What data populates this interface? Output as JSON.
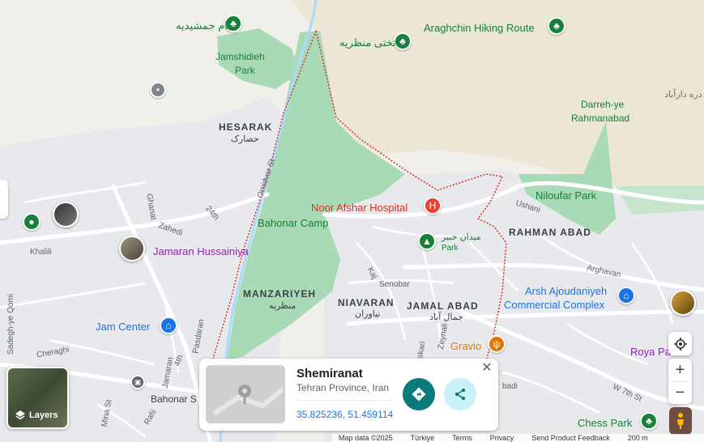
{
  "map": {
    "areas": {
      "hesarak": "HESARAK",
      "hesarak_fa": "حصارک",
      "manzariyeh": "MANZARIYEH",
      "manzariyeh_fa": "منظریه",
      "niavaran": "NIAVARAN",
      "niavaran_fa": "نیاوران",
      "jamal_abad": "JAMAL ABAD",
      "jamal_abad_fa": "جمال آباد",
      "rahman_abad": "RAHMAN ABAD"
    },
    "terrain": {
      "darreh": "Darreh-ye",
      "rahmanabad": "Rahmanabad",
      "jamshidieh": "Jamshidieh",
      "park": "Park",
      "dar_abad_fa": "دره دارآباد"
    },
    "pois": {
      "bam_jamshidieh": "بام جمشیدیه",
      "takhti": "تختی منظریه",
      "araghchin": "Araghchin Hiking Route",
      "noor_afshar": "Noor Afshar Hospital",
      "bahonar_camp": "Bahonar Camp",
      "khabir_fa": "میدان خبیر",
      "khabir_park": "Park",
      "niloufar": "Niloufar Park",
      "jamaran": "Jamaran Hussainiya",
      "arsh_1": "Arsh Ajoudaniyeh",
      "arsh_2": "Commercial Complex",
      "jam_center": "Jam Center",
      "gravio": "Gravio",
      "roya": "Roya Pa",
      "chess": "Chess Park",
      "bahonar_s": "Bahonar S"
    },
    "streets": {
      "omidvar": "Omidvar St",
      "ghanat": "Ghanat",
      "zahedi": "Zahedi",
      "twentyfourth": "24th",
      "khalili": "Khalili",
      "ushani": "Ushani",
      "arghavan": "Arghavan",
      "senobar": "Senobar",
      "kaj": "Kaj",
      "askari": "Askari",
      "zeynali": "Zeynali",
      "cheraghi": "Cheraghi",
      "jamaran": "Jamaran",
      "fourth": "4th",
      "mina": "Mina St",
      "rafii": "Rafii",
      "w7th": "W 7th St",
      "badi": "badi",
      "sadeghiye": "Sadegh-ye Qomi",
      "pasdaran": "Pasdaran"
    },
    "colors": {
      "land": "#f1efe9",
      "terrain": "#ece6d4",
      "urban": "#e8e9ed",
      "park": "#a8dab5",
      "road": "#ffffff",
      "water": "#aadaff",
      "boundary": "#d93025"
    }
  },
  "card": {
    "title": "Shemiranat",
    "subtitle": "Tehran Province, Iran",
    "coords": "35.825236, 51.459114",
    "close_icon": "close-icon",
    "directions_icon": "directions-icon",
    "share_icon": "share-icon"
  },
  "controls": {
    "layers_label": "Layers",
    "zoom_in": "+",
    "zoom_out": "−",
    "locate_icon": "my-location-icon"
  },
  "footer": {
    "items": [
      "Map data ©2025",
      "Türkiye",
      "Terms",
      "Privacy",
      "Send Product Feedback",
      "200 m"
    ]
  }
}
